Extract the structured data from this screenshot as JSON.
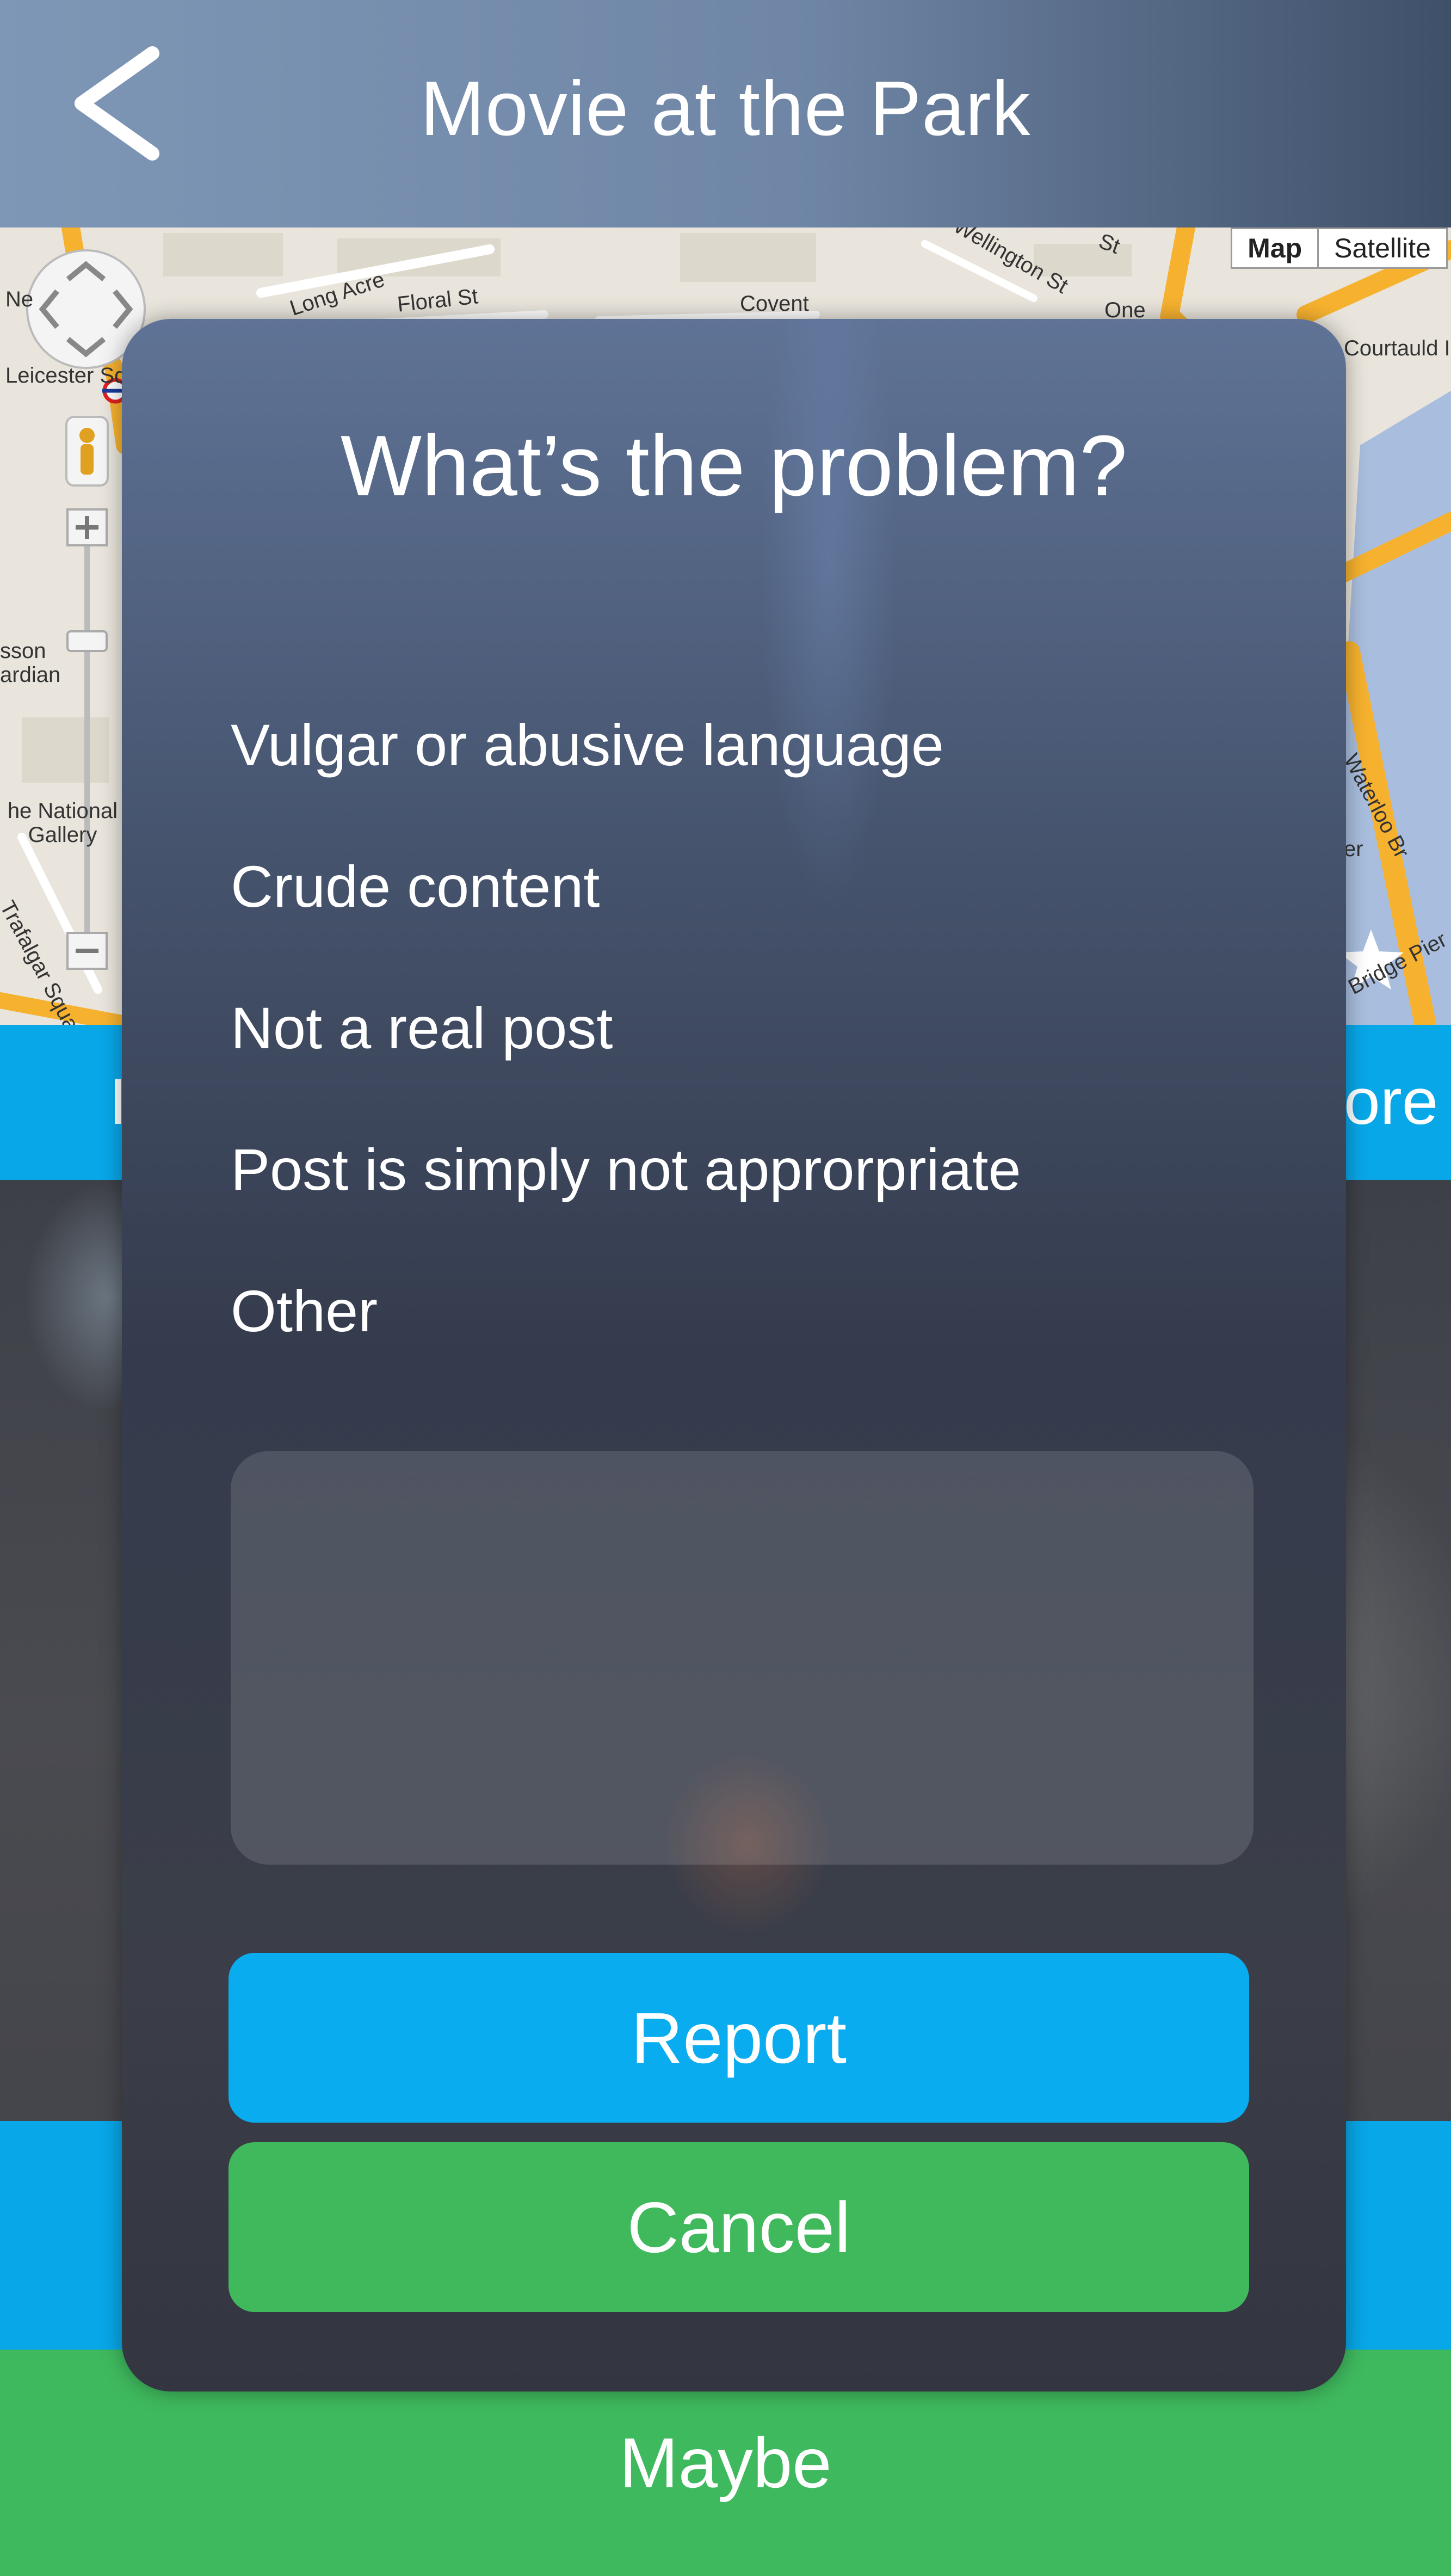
{
  "header": {
    "title": "Movie at the Park",
    "back_icon": "chevron-left-icon"
  },
  "map": {
    "type_buttons": [
      "Map",
      "Satellite"
    ],
    "labels": {
      "leicester_square": "Leicester Square",
      "long_acre": "Long Acre",
      "floral_st": "Floral St",
      "covent": "Covent",
      "national_gallery": "he National Gallery",
      "trafalgar": "Trafalgar Square",
      "waterloo": "Waterloo Br",
      "courtauld": "Courtauld Institute of Ar",
      "bridge_pier": "Bridge Pier",
      "wellington_st": "Wellington St",
      "one": "One",
      "st": "St",
      "sson": "sson",
      "ardian": "ardian",
      "er": "er",
      "ne": "Ne"
    },
    "colors": {
      "road": "#f6b12f",
      "water": "#a9bede",
      "land": "#e9e5dc"
    }
  },
  "background": {
    "band_left_text": "I",
    "band_right_text": "ore",
    "maybe_label": "Maybe"
  },
  "modal": {
    "title": "What’s the problem?",
    "options": [
      "Vulgar or abusive language",
      "Crude content",
      "Not a real post",
      "Post is simply not approrpriate",
      "Other"
    ],
    "details_placeholder": "",
    "report_label": "Report",
    "cancel_label": "Cancel"
  },
  "colors": {
    "accent_blue": "#08acef",
    "accent_green": "#40b95d"
  }
}
